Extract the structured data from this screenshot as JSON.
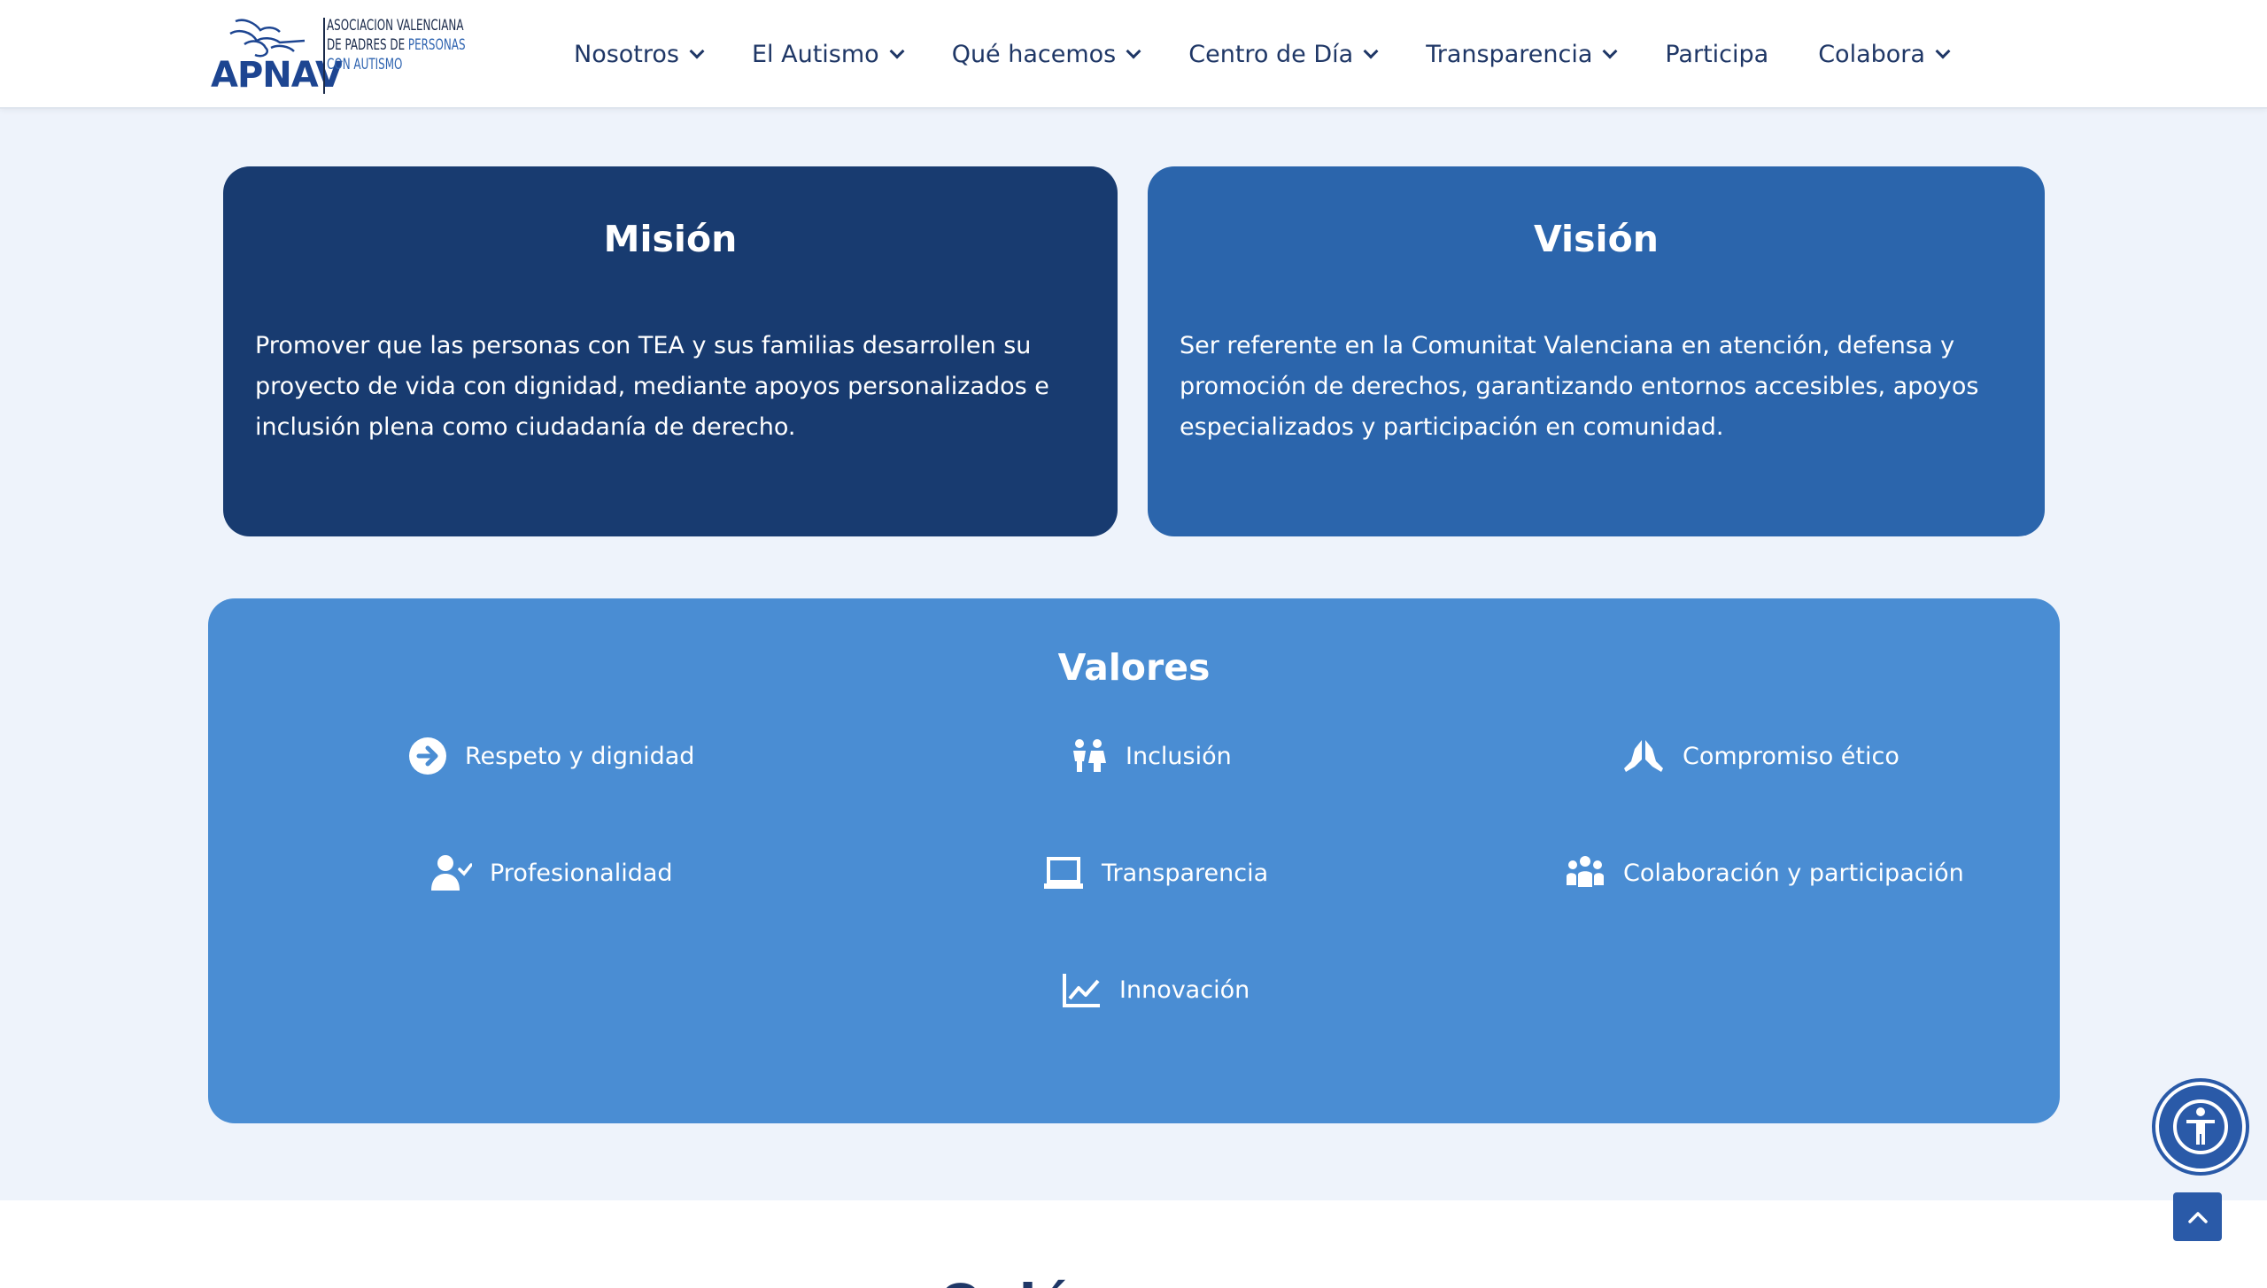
{
  "logo": {
    "brand": "APNAV",
    "line1": "ASOCIACION VALENCIANA",
    "line2_a": "DE PADRES DE ",
    "line2_b": "PERSONAS",
    "line3": "CON AUTISMO"
  },
  "nav": {
    "items": [
      {
        "label": "Nosotros",
        "dropdown": true
      },
      {
        "label": "El Autismo",
        "dropdown": true
      },
      {
        "label": "Qué hacemos",
        "dropdown": true
      },
      {
        "label": "Centro de Día",
        "dropdown": true
      },
      {
        "label": "Transparencia",
        "dropdown": true
      },
      {
        "label": "Participa",
        "dropdown": false
      },
      {
        "label": "Colabora",
        "dropdown": true
      }
    ]
  },
  "mision": {
    "title": "Misión",
    "text": "Promover que las personas con TEA y sus familias desarrollen su proyecto de vida con dignidad, mediante apoyos personalizados e inclusión plena como ciudadanía de derecho."
  },
  "vision": {
    "title": "Visión",
    "text": "Ser referente en la Comunitat Valenciana en atención, defensa y promoción de derechos, garantizando entornos accesibles, apoyos especializados y participación en comunidad."
  },
  "valores": {
    "title": "Valores",
    "items": [
      {
        "label": "Respeto y dignidad",
        "icon": "arrow-circle-right-icon"
      },
      {
        "label": "Inclusión",
        "icon": "children-icon"
      },
      {
        "label": "Compromiso ético",
        "icon": "praying-hands-icon"
      },
      {
        "label": "Profesionalidad",
        "icon": "user-check-icon"
      },
      {
        "label": "Transparencia",
        "icon": "laptop-icon"
      },
      {
        "label": "Colaboración y participación",
        "icon": "users-group-icon"
      },
      {
        "label": "Innovación",
        "icon": "chart-line-icon"
      }
    ]
  },
  "lower": {
    "title_partial": "Quién"
  },
  "colors": {
    "mision_bg": "#183b70",
    "vision_bg": "#2b65ac",
    "valores_bg": "#4a8dd3",
    "page_bg": "#eef3fb",
    "nav_text": "#1f3766"
  }
}
